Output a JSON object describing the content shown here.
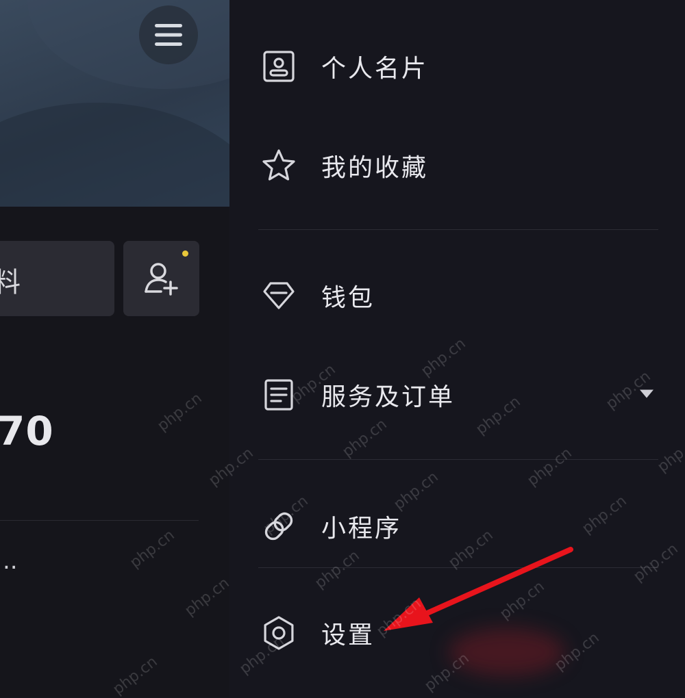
{
  "profile": {
    "edit_label_fragment": "料",
    "stat_value": "70",
    "more_text": "..",
    "accent_dot_color": "#e8c73a"
  },
  "drawer": {
    "items": [
      {
        "label": "个人名片",
        "icon": "id-card-icon"
      },
      {
        "label": "我的收藏",
        "icon": "star-icon"
      },
      {
        "label": "钱包",
        "icon": "diamond-icon"
      },
      {
        "label": "服务及订单",
        "icon": "document-list-icon",
        "expandable": true
      },
      {
        "label": "小程序",
        "icon": "mini-program-icon"
      },
      {
        "label": "设置",
        "icon": "gear-icon"
      }
    ]
  },
  "annotation": {
    "arrow_color": "#e8141c"
  },
  "watermark": {
    "text": "php.cn"
  }
}
